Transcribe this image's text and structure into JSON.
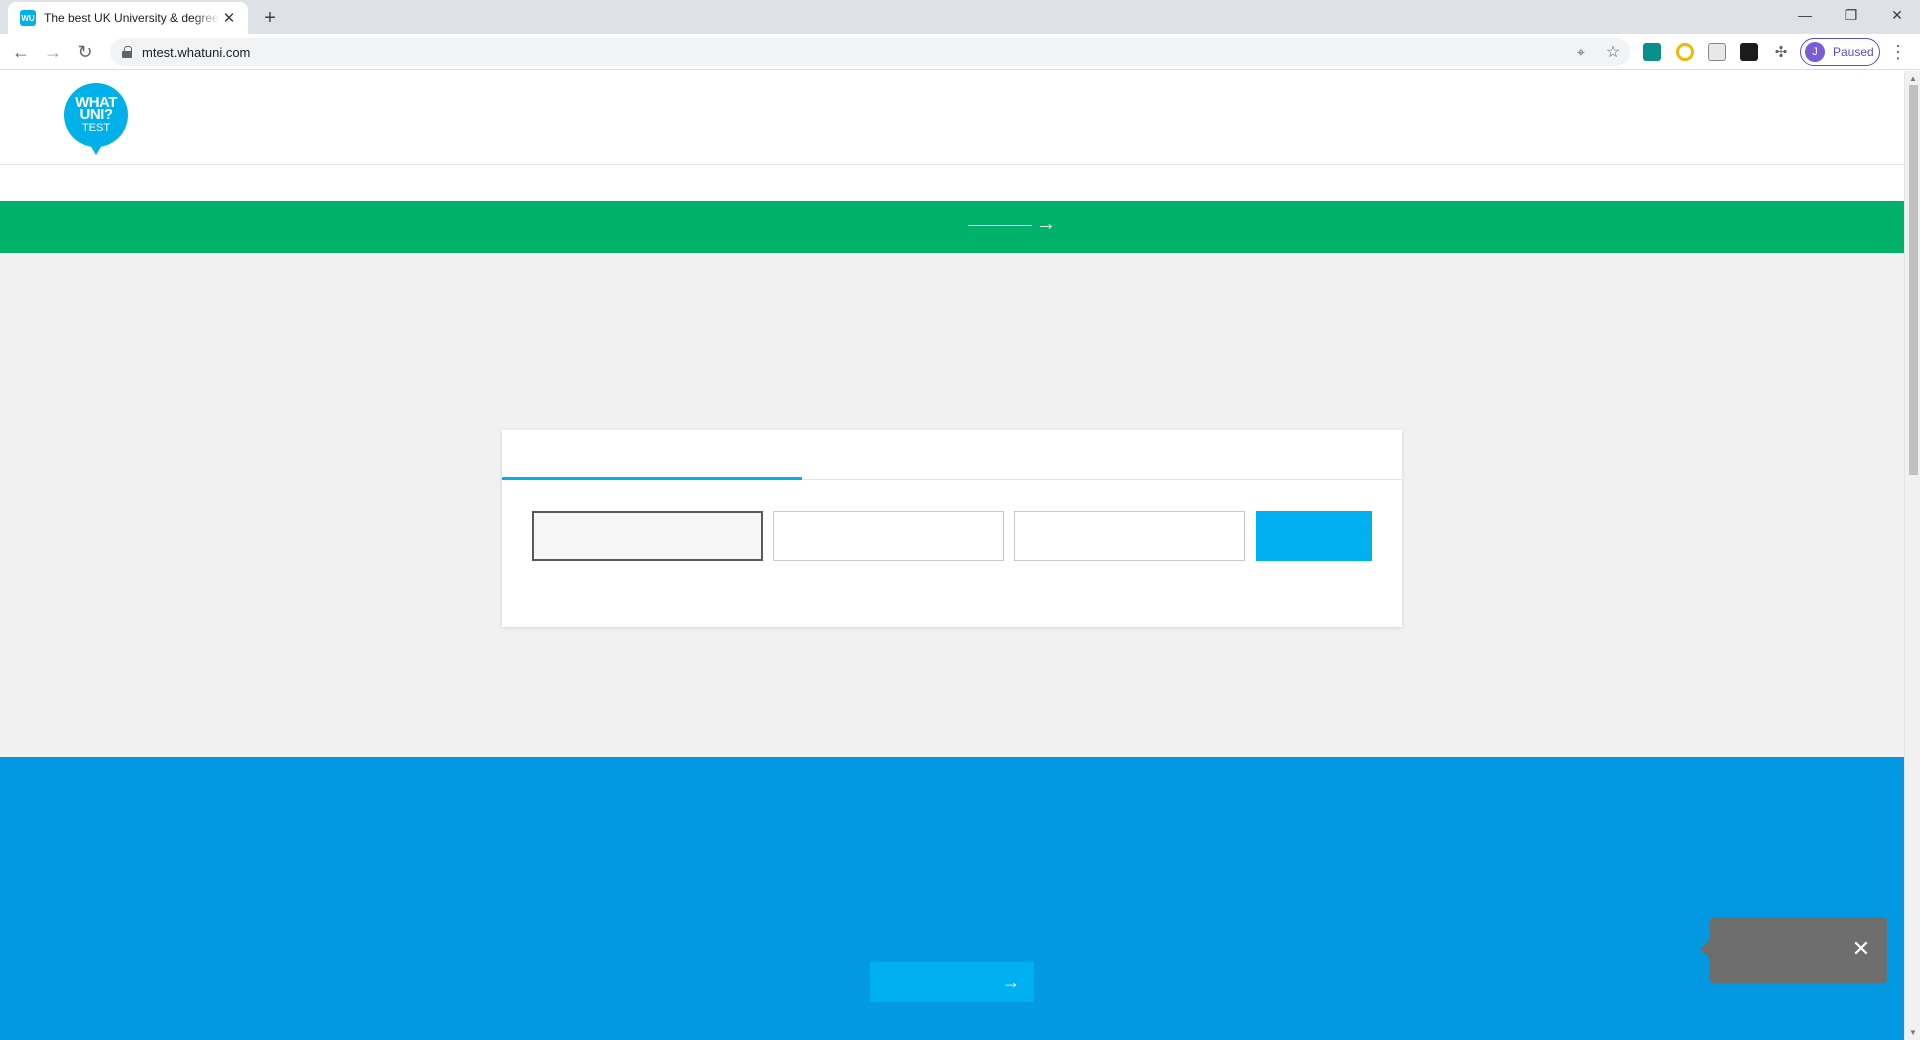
{
  "browser": {
    "tab_title": "The best UK University & degree",
    "favicon_text": "WU",
    "close_glyph": "✕",
    "new_tab_glyph": "+",
    "window": {
      "minimize": "—",
      "restore": "❐",
      "close": "✕"
    },
    "url": "mtest.whatuni.com",
    "profile_initial": "J",
    "profile_status": "Paused",
    "icons": [
      "back-icon",
      "forward-icon",
      "reload-icon",
      "lock-icon",
      "location-icon",
      "star-icon",
      "extensions-icon",
      "menu-icon"
    ]
  },
  "site": {
    "logo": {
      "line1": "WHAT",
      "line2": "UNI?",
      "line3": "TEST"
    },
    "banner_arrow": "→",
    "cta_arrow": "→",
    "tooltip_close": "✕"
  },
  "colors": {
    "brand_blue": "#00b0e8",
    "banner_green": "#00b16a",
    "section_blue": "#0398e2",
    "button_blue": "#00b0f0"
  }
}
